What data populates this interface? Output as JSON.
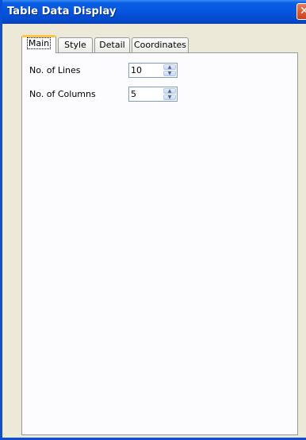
{
  "window": {
    "title": "Table Data Display"
  },
  "tabs": [
    {
      "label": "Main",
      "active": true
    },
    {
      "label": "Style",
      "active": false
    },
    {
      "label": "Detail",
      "active": false
    },
    {
      "label": "Coordinates",
      "active": false
    }
  ],
  "main": {
    "lines": {
      "label": "No. of Lines",
      "value": "10"
    },
    "columns": {
      "label": "No. of Columns",
      "value": "5"
    }
  },
  "icons": {
    "close": "close-icon",
    "spin_up": "chevron-up-icon",
    "spin_down": "chevron-down-icon"
  }
}
